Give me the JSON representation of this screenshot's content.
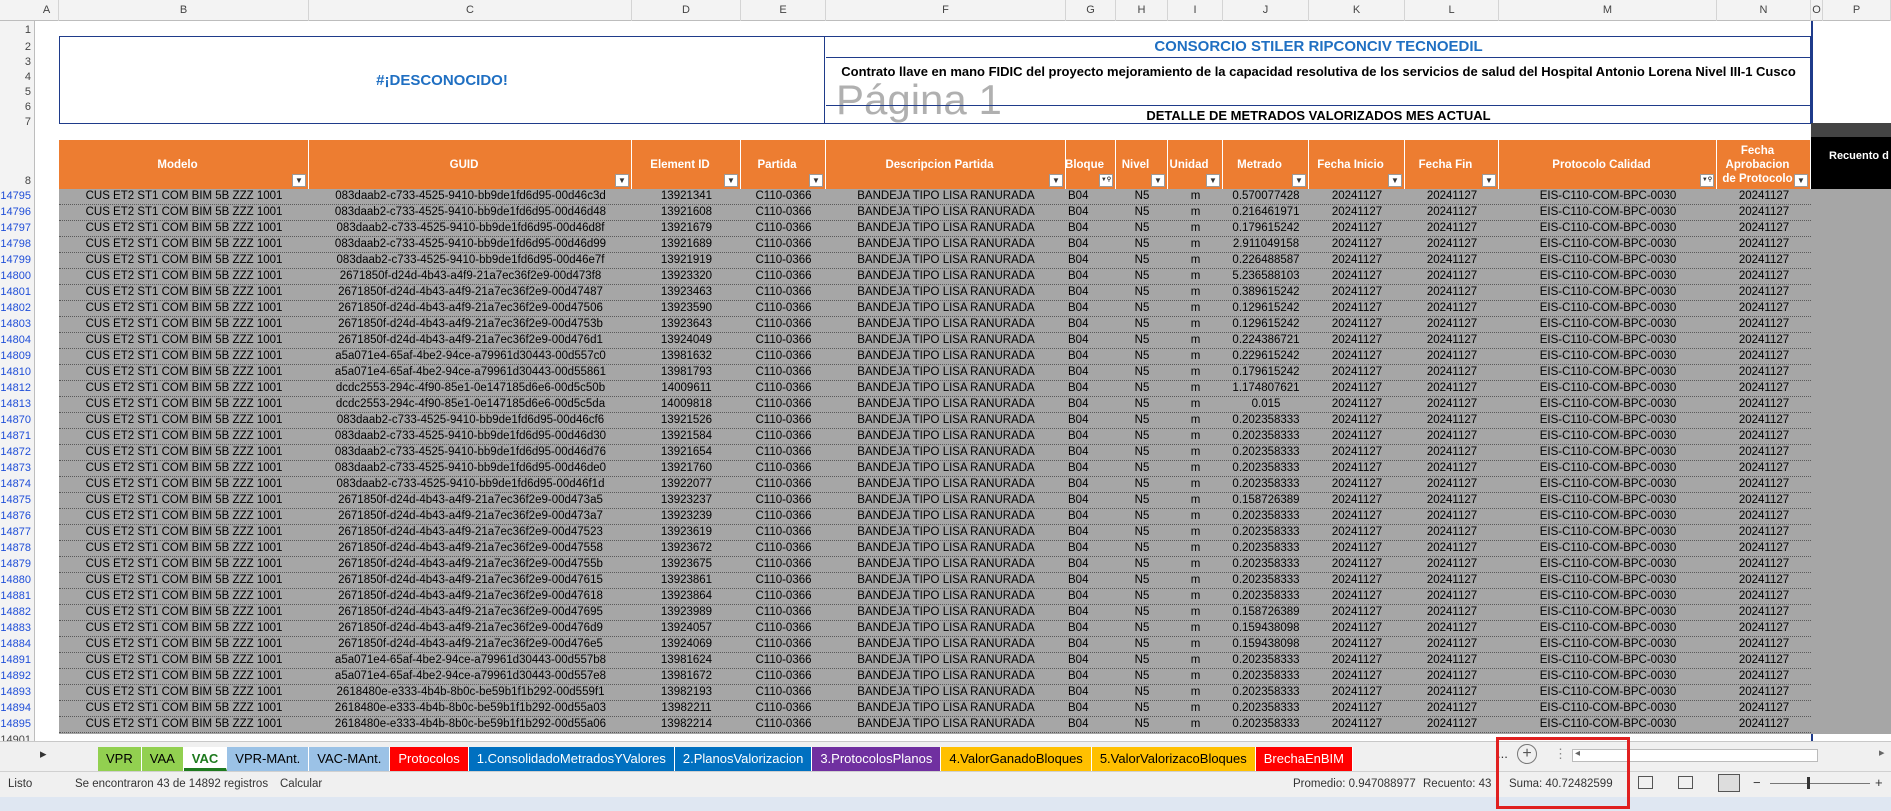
{
  "columns": [
    "A",
    "B",
    "C",
    "D",
    "E",
    "F",
    "G",
    "H",
    "I",
    "J",
    "K",
    "L",
    "M",
    "N",
    "O",
    "P"
  ],
  "title_block": {
    "unknown_label": "#¡DESCONOCIDO!",
    "consorcio": "CONSORCIO STILER RIPCONCIV TECNOEDIL",
    "contrato": "Contrato llave en mano FIDIC del proyecto mejoramiento de la capacidad resolutiva de los servicios de salud del Hospital Antonio Lorena Nivel III-1 Cusco",
    "pagina": "Página 1",
    "detalle": "DETALLE DE METRADOS VALORIZADOS MES ACTUAL"
  },
  "top_row_numbers": [
    "1",
    "2",
    "3",
    "4",
    "5",
    "6",
    "7",
    "8"
  ],
  "headers": [
    "Modelo",
    "GUID",
    "Element ID",
    "Partida",
    "Descripcion Partida",
    "Bloque",
    "Nivel",
    "Unidad",
    "Metrado",
    "Fecha Inicio",
    "Fecha Fin",
    "Protocolo Calidad",
    "Fecha Aprobacion de Protocolo"
  ],
  "header_filter_active": [
    false,
    false,
    false,
    false,
    false,
    true,
    false,
    false,
    false,
    false,
    false,
    true,
    false
  ],
  "side_header": "Recuento d",
  "rows": [
    [
      "14795",
      "CUS ET2 ST1 COM BIM 5B ZZZ 1001",
      "083daab2-c733-4525-9410-bb9de1fd6d95-00d46c3d",
      "13921341",
      "C110-0366",
      "BANDEJA TIPO LISA RANURADA",
      "B04",
      "N5",
      "m",
      "0.570077428",
      "20241127",
      "20241127",
      "EIS-C110-COM-BPC-0030",
      "20241127"
    ],
    [
      "14796",
      "CUS ET2 ST1 COM BIM 5B ZZZ 1001",
      "083daab2-c733-4525-9410-bb9de1fd6d95-00d46d48",
      "13921608",
      "C110-0366",
      "BANDEJA TIPO LISA RANURADA",
      "B04",
      "N5",
      "m",
      "0.216461971",
      "20241127",
      "20241127",
      "EIS-C110-COM-BPC-0030",
      "20241127"
    ],
    [
      "14797",
      "CUS ET2 ST1 COM BIM 5B ZZZ 1001",
      "083daab2-c733-4525-9410-bb9de1fd6d95-00d46d8f",
      "13921679",
      "C110-0366",
      "BANDEJA TIPO LISA RANURADA",
      "B04",
      "N5",
      "m",
      "0.179615242",
      "20241127",
      "20241127",
      "EIS-C110-COM-BPC-0030",
      "20241127"
    ],
    [
      "14798",
      "CUS ET2 ST1 COM BIM 5B ZZZ 1001",
      "083daab2-c733-4525-9410-bb9de1fd6d95-00d46d99",
      "13921689",
      "C110-0366",
      "BANDEJA TIPO LISA RANURADA",
      "B04",
      "N5",
      "m",
      "2.911049158",
      "20241127",
      "20241127",
      "EIS-C110-COM-BPC-0030",
      "20241127"
    ],
    [
      "14799",
      "CUS ET2 ST1 COM BIM 5B ZZZ 1001",
      "083daab2-c733-4525-9410-bb9de1fd6d95-00d46e7f",
      "13921919",
      "C110-0366",
      "BANDEJA TIPO LISA RANURADA",
      "B04",
      "N5",
      "m",
      "0.226488587",
      "20241127",
      "20241127",
      "EIS-C110-COM-BPC-0030",
      "20241127"
    ],
    [
      "14800",
      "CUS ET2 ST1 COM BIM 5B ZZZ 1001",
      "2671850f-d24d-4b43-a4f9-21a7ec36f2e9-00d473f8",
      "13923320",
      "C110-0366",
      "BANDEJA TIPO LISA RANURADA",
      "B04",
      "N5",
      "m",
      "5.236588103",
      "20241127",
      "20241127",
      "EIS-C110-COM-BPC-0030",
      "20241127"
    ],
    [
      "14801",
      "CUS ET2 ST1 COM BIM 5B ZZZ 1001",
      "2671850f-d24d-4b43-a4f9-21a7ec36f2e9-00d47487",
      "13923463",
      "C110-0366",
      "BANDEJA TIPO LISA RANURADA",
      "B04",
      "N5",
      "m",
      "0.389615242",
      "20241127",
      "20241127",
      "EIS-C110-COM-BPC-0030",
      "20241127"
    ],
    [
      "14802",
      "CUS ET2 ST1 COM BIM 5B ZZZ 1001",
      "2671850f-d24d-4b43-a4f9-21a7ec36f2e9-00d47506",
      "13923590",
      "C110-0366",
      "BANDEJA TIPO LISA RANURADA",
      "B04",
      "N5",
      "m",
      "0.129615242",
      "20241127",
      "20241127",
      "EIS-C110-COM-BPC-0030",
      "20241127"
    ],
    [
      "14803",
      "CUS ET2 ST1 COM BIM 5B ZZZ 1001",
      "2671850f-d24d-4b43-a4f9-21a7ec36f2e9-00d4753b",
      "13923643",
      "C110-0366",
      "BANDEJA TIPO LISA RANURADA",
      "B04",
      "N5",
      "m",
      "0.129615242",
      "20241127",
      "20241127",
      "EIS-C110-COM-BPC-0030",
      "20241127"
    ],
    [
      "14804",
      "CUS ET2 ST1 COM BIM 5B ZZZ 1001",
      "2671850f-d24d-4b43-a4f9-21a7ec36f2e9-00d476d1",
      "13924049",
      "C110-0366",
      "BANDEJA TIPO LISA RANURADA",
      "B04",
      "N5",
      "m",
      "0.224386721",
      "20241127",
      "20241127",
      "EIS-C110-COM-BPC-0030",
      "20241127"
    ],
    [
      "14809",
      "CUS ET2 ST1 COM BIM 5B ZZZ 1001",
      "a5a071e4-65af-4be2-94ce-a79961d30443-00d557c0",
      "13981632",
      "C110-0366",
      "BANDEJA TIPO LISA RANURADA",
      "B04",
      "N5",
      "m",
      "0.229615242",
      "20241127",
      "20241127",
      "EIS-C110-COM-BPC-0030",
      "20241127"
    ],
    [
      "14810",
      "CUS ET2 ST1 COM BIM 5B ZZZ 1001",
      "a5a071e4-65af-4be2-94ce-a79961d30443-00d55861",
      "13981793",
      "C110-0366",
      "BANDEJA TIPO LISA RANURADA",
      "B04",
      "N5",
      "m",
      "0.179615242",
      "20241127",
      "20241127",
      "EIS-C110-COM-BPC-0030",
      "20241127"
    ],
    [
      "14812",
      "CUS ET2 ST1 COM BIM 5B ZZZ 1001",
      "dcdc2553-294c-4f90-85e1-0e147185d6e6-00d5c50b",
      "14009611",
      "C110-0366",
      "BANDEJA TIPO LISA RANURADA",
      "B04",
      "N5",
      "m",
      "1.174807621",
      "20241127",
      "20241127",
      "EIS-C110-COM-BPC-0030",
      "20241127"
    ],
    [
      "14813",
      "CUS ET2 ST1 COM BIM 5B ZZZ 1001",
      "dcdc2553-294c-4f90-85e1-0e147185d6e6-00d5c5da",
      "14009818",
      "C110-0366",
      "BANDEJA TIPO LISA RANURADA",
      "B04",
      "N5",
      "m",
      "0.015",
      "20241127",
      "20241127",
      "EIS-C110-COM-BPC-0030",
      "20241127"
    ],
    [
      "14870",
      "CUS ET2 ST1 COM BIM 5B ZZZ 1001",
      "083daab2-c733-4525-9410-bb9de1fd6d95-00d46cf6",
      "13921526",
      "C110-0366",
      "BANDEJA TIPO LISA RANURADA",
      "B04",
      "N5",
      "m",
      "0.202358333",
      "20241127",
      "20241127",
      "EIS-C110-COM-BPC-0030",
      "20241127"
    ],
    [
      "14871",
      "CUS ET2 ST1 COM BIM 5B ZZZ 1001",
      "083daab2-c733-4525-9410-bb9de1fd6d95-00d46d30",
      "13921584",
      "C110-0366",
      "BANDEJA TIPO LISA RANURADA",
      "B04",
      "N5",
      "m",
      "0.202358333",
      "20241127",
      "20241127",
      "EIS-C110-COM-BPC-0030",
      "20241127"
    ],
    [
      "14872",
      "CUS ET2 ST1 COM BIM 5B ZZZ 1001",
      "083daab2-c733-4525-9410-bb9de1fd6d95-00d46d76",
      "13921654",
      "C110-0366",
      "BANDEJA TIPO LISA RANURADA",
      "B04",
      "N5",
      "m",
      "0.202358333",
      "20241127",
      "20241127",
      "EIS-C110-COM-BPC-0030",
      "20241127"
    ],
    [
      "14873",
      "CUS ET2 ST1 COM BIM 5B ZZZ 1001",
      "083daab2-c733-4525-9410-bb9de1fd6d95-00d46de0",
      "13921760",
      "C110-0366",
      "BANDEJA TIPO LISA RANURADA",
      "B04",
      "N5",
      "m",
      "0.202358333",
      "20241127",
      "20241127",
      "EIS-C110-COM-BPC-0030",
      "20241127"
    ],
    [
      "14874",
      "CUS ET2 ST1 COM BIM 5B ZZZ 1001",
      "083daab2-c733-4525-9410-bb9de1fd6d95-00d46f1d",
      "13922077",
      "C110-0366",
      "BANDEJA TIPO LISA RANURADA",
      "B04",
      "N5",
      "m",
      "0.202358333",
      "20241127",
      "20241127",
      "EIS-C110-COM-BPC-0030",
      "20241127"
    ],
    [
      "14875",
      "CUS ET2 ST1 COM BIM 5B ZZZ 1001",
      "2671850f-d24d-4b43-a4f9-21a7ec36f2e9-00d473a5",
      "13923237",
      "C110-0366",
      "BANDEJA TIPO LISA RANURADA",
      "B04",
      "N5",
      "m",
      "0.158726389",
      "20241127",
      "20241127",
      "EIS-C110-COM-BPC-0030",
      "20241127"
    ],
    [
      "14876",
      "CUS ET2 ST1 COM BIM 5B ZZZ 1001",
      "2671850f-d24d-4b43-a4f9-21a7ec36f2e9-00d473a7",
      "13923239",
      "C110-0366",
      "BANDEJA TIPO LISA RANURADA",
      "B04",
      "N5",
      "m",
      "0.202358333",
      "20241127",
      "20241127",
      "EIS-C110-COM-BPC-0030",
      "20241127"
    ],
    [
      "14877",
      "CUS ET2 ST1 COM BIM 5B ZZZ 1001",
      "2671850f-d24d-4b43-a4f9-21a7ec36f2e9-00d47523",
      "13923619",
      "C110-0366",
      "BANDEJA TIPO LISA RANURADA",
      "B04",
      "N5",
      "m",
      "0.202358333",
      "20241127",
      "20241127",
      "EIS-C110-COM-BPC-0030",
      "20241127"
    ],
    [
      "14878",
      "CUS ET2 ST1 COM BIM 5B ZZZ 1001",
      "2671850f-d24d-4b43-a4f9-21a7ec36f2e9-00d47558",
      "13923672",
      "C110-0366",
      "BANDEJA TIPO LISA RANURADA",
      "B04",
      "N5",
      "m",
      "0.202358333",
      "20241127",
      "20241127",
      "EIS-C110-COM-BPC-0030",
      "20241127"
    ],
    [
      "14879",
      "CUS ET2 ST1 COM BIM 5B ZZZ 1001",
      "2671850f-d24d-4b43-a4f9-21a7ec36f2e9-00d4755b",
      "13923675",
      "C110-0366",
      "BANDEJA TIPO LISA RANURADA",
      "B04",
      "N5",
      "m",
      "0.202358333",
      "20241127",
      "20241127",
      "EIS-C110-COM-BPC-0030",
      "20241127"
    ],
    [
      "14880",
      "CUS ET2 ST1 COM BIM 5B ZZZ 1001",
      "2671850f-d24d-4b43-a4f9-21a7ec36f2e9-00d47615",
      "13923861",
      "C110-0366",
      "BANDEJA TIPO LISA RANURADA",
      "B04",
      "N5",
      "m",
      "0.202358333",
      "20241127",
      "20241127",
      "EIS-C110-COM-BPC-0030",
      "20241127"
    ],
    [
      "14881",
      "CUS ET2 ST1 COM BIM 5B ZZZ 1001",
      "2671850f-d24d-4b43-a4f9-21a7ec36f2e9-00d47618",
      "13923864",
      "C110-0366",
      "BANDEJA TIPO LISA RANURADA",
      "B04",
      "N5",
      "m",
      "0.202358333",
      "20241127",
      "20241127",
      "EIS-C110-COM-BPC-0030",
      "20241127"
    ],
    [
      "14882",
      "CUS ET2 ST1 COM BIM 5B ZZZ 1001",
      "2671850f-d24d-4b43-a4f9-21a7ec36f2e9-00d47695",
      "13923989",
      "C110-0366",
      "BANDEJA TIPO LISA RANURADA",
      "B04",
      "N5",
      "m",
      "0.158726389",
      "20241127",
      "20241127",
      "EIS-C110-COM-BPC-0030",
      "20241127"
    ],
    [
      "14883",
      "CUS ET2 ST1 COM BIM 5B ZZZ 1001",
      "2671850f-d24d-4b43-a4f9-21a7ec36f2e9-00d476d9",
      "13924057",
      "C110-0366",
      "BANDEJA TIPO LISA RANURADA",
      "B04",
      "N5",
      "m",
      "0.159438098",
      "20241127",
      "20241127",
      "EIS-C110-COM-BPC-0030",
      "20241127"
    ],
    [
      "14884",
      "CUS ET2 ST1 COM BIM 5B ZZZ 1001",
      "2671850f-d24d-4b43-a4f9-21a7ec36f2e9-00d476e5",
      "13924069",
      "C110-0366",
      "BANDEJA TIPO LISA RANURADA",
      "B04",
      "N5",
      "m",
      "0.159438098",
      "20241127",
      "20241127",
      "EIS-C110-COM-BPC-0030",
      "20241127"
    ],
    [
      "14891",
      "CUS ET2 ST1 COM BIM 5B ZZZ 1001",
      "a5a071e4-65af-4be2-94ce-a79961d30443-00d557b8",
      "13981624",
      "C110-0366",
      "BANDEJA TIPO LISA RANURADA",
      "B04",
      "N5",
      "m",
      "0.202358333",
      "20241127",
      "20241127",
      "EIS-C110-COM-BPC-0030",
      "20241127"
    ],
    [
      "14892",
      "CUS ET2 ST1 COM BIM 5B ZZZ 1001",
      "a5a071e4-65af-4be2-94ce-a79961d30443-00d557e8",
      "13981672",
      "C110-0366",
      "BANDEJA TIPO LISA RANURADA",
      "B04",
      "N5",
      "m",
      "0.202358333",
      "20241127",
      "20241127",
      "EIS-C110-COM-BPC-0030",
      "20241127"
    ],
    [
      "14893",
      "CUS ET2 ST1 COM BIM 5B ZZZ 1001",
      "2618480e-e333-4b4b-8b0c-be59b1f1b292-00d559f1",
      "13982193",
      "C110-0366",
      "BANDEJA TIPO LISA RANURADA",
      "B04",
      "N5",
      "m",
      "0.202358333",
      "20241127",
      "20241127",
      "EIS-C110-COM-BPC-0030",
      "20241127"
    ],
    [
      "14894",
      "CUS ET2 ST1 COM BIM 5B ZZZ 1001",
      "2618480e-e333-4b4b-8b0c-be59b1f1b292-00d55a03",
      "13982211",
      "C110-0366",
      "BANDEJA TIPO LISA RANURADA",
      "B04",
      "N5",
      "m",
      "0.202358333",
      "20241127",
      "20241127",
      "EIS-C110-COM-BPC-0030",
      "20241127"
    ],
    [
      "14895",
      "CUS ET2 ST1 COM BIM 5B ZZZ 1001",
      "2618480e-e333-4b4b-8b0c-be59b1f1b292-00d55a06",
      "13982214",
      "C110-0366",
      "BANDEJA TIPO LISA RANURADA",
      "B04",
      "N5",
      "m",
      "0.202358333",
      "20241127",
      "20241127",
      "EIS-C110-COM-BPC-0030",
      "20241127"
    ]
  ],
  "last_row_number": "14901",
  "tabs": [
    {
      "label": "VPR",
      "bg": "#92d050",
      "fg": "#000000"
    },
    {
      "label": "VAA",
      "bg": "#92d050",
      "fg": "#000000"
    },
    {
      "label": "VAC",
      "bg": "#ffffff",
      "fg": "#1e7a1e"
    },
    {
      "label": "VPR-MAnt.",
      "bg": "#9bc2e6",
      "fg": "#000000"
    },
    {
      "label": "VAC-MAnt.",
      "bg": "#9bc2e6",
      "fg": "#000000"
    },
    {
      "label": "Protocolos",
      "bg": "#ff0000",
      "fg": "#ffffff"
    },
    {
      "label": "1.ConsolidadoMetradosYValores",
      "bg": "#0070c0",
      "fg": "#ffffff"
    },
    {
      "label": "2.PlanosValorizacion",
      "bg": "#0070c0",
      "fg": "#ffffff"
    },
    {
      "label": "3.ProtocolosPlanos",
      "bg": "#7030a0",
      "fg": "#ffffff"
    },
    {
      "label": "4.ValorGanadoBloques",
      "bg": "#ffc000",
      "fg": "#000000"
    },
    {
      "label": "5.ValorValorizacoBloques",
      "bg": "#ffc000",
      "fg": "#000000"
    },
    {
      "label": "BrechaEnBIM",
      "bg": "#ff0000",
      "fg": "#ffffff"
    }
  ],
  "tab_overflow": "...",
  "status": {
    "ready": "Listo",
    "found": "Se encontraron 43 de 14892 registros",
    "calc": "Calcular",
    "promedio": "Promedio: 0.947088977",
    "recuento": "Recuento: 43",
    "suma": "Suma: 40.72482599"
  },
  "colors": {
    "header_orange": "#ed7d31",
    "filtered_rows_gray": "#a6a6a6",
    "title_blue": "#1f6fc2",
    "highlight_red": "#e02020"
  }
}
